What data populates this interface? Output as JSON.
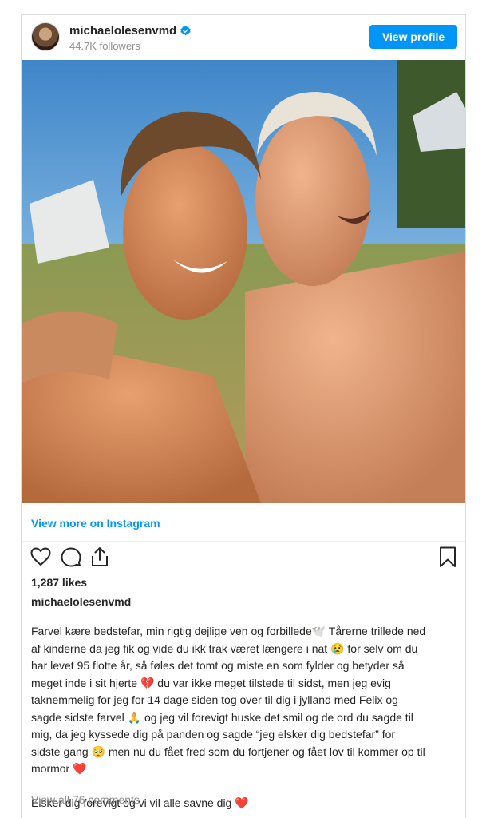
{
  "header": {
    "username": "michaelolesenvmd",
    "followers": "44.7K followers",
    "view_profile_label": "View profile"
  },
  "post": {
    "view_more_label": "View more on Instagram",
    "likes": "1,287 likes",
    "caption_username": "michaelolesenvmd",
    "caption_lines": [
      "Farvel kære bedstefar, min rigtig dejlige ven og forbillede🕊️ Tårerne trillede ned",
      "af kinderne da jeg fik og vide du ikk trak været længere i nat 😢 for selv om du",
      "har levet 95 flotte år, så føles det tomt og miste en som fylder og betyder så",
      "meget inde i sit hjerte 💔 du var ikke meget tilstede til sidst, men jeg evig",
      "taknemmelig for jeg for 14 dage siden tog over til dig i jylland med Felix og",
      "sagde sidste farvel 🙏 og jeg vil forevigt huske det smil og de ord du sagde til",
      "mig, da jeg kyssede dig på panden og sagde “jeg elsker dig bedstefar” for",
      "sidste gang 🥺 men nu du fået fred som du fortjener og fået lov til kommer op til",
      "mormor ❤️"
    ],
    "caption_closing": "Elsker dig forevigt og vi vil alle savne dig ❤️",
    "view_comments_label": "View all 76 comments"
  },
  "icons": {
    "verified": "verified-badge-icon",
    "like": "heart-icon",
    "comment": "comment-bubble-icon",
    "share": "share-icon",
    "save": "bookmark-icon"
  },
  "colors": {
    "accent": "#0095f6",
    "text": "#262626",
    "muted": "#8e8e8e",
    "border": "#dbdbdb"
  }
}
